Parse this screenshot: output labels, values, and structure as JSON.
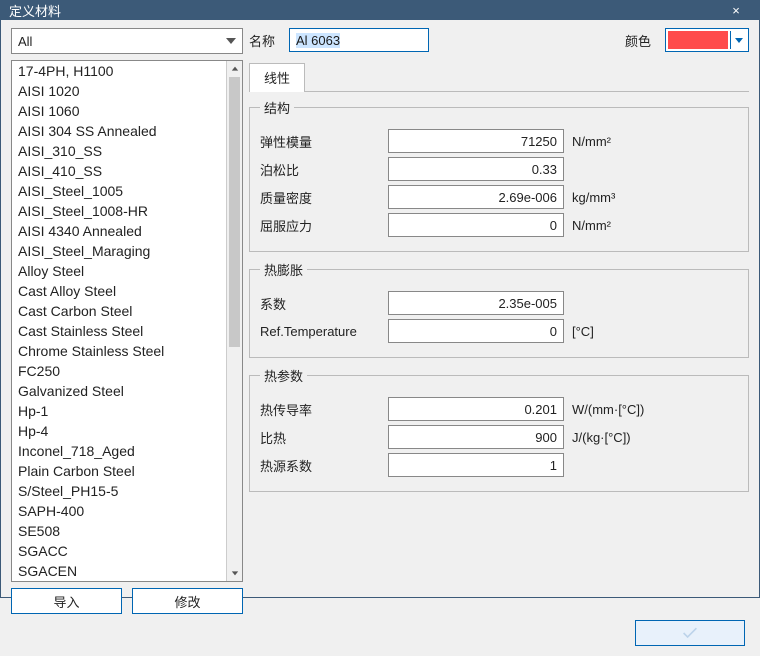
{
  "window": {
    "title": "定义材料"
  },
  "filter": {
    "value": "All"
  },
  "materials": [
    "17-4PH, H1100",
    "AISI 1020",
    "AISI 1060",
    "AISI 304 SS Annealed",
    "AISI_310_SS",
    "AISI_410_SS",
    "AISI_Steel_1005",
    "AISI_Steel_1008-HR",
    "AISI 4340 Annealed",
    "AISI_Steel_Maraging",
    "Alloy Steel",
    "Cast Alloy Steel",
    "Cast Carbon Steel",
    "Cast Stainless Steel",
    "Chrome Stainless Steel",
    "FC250",
    "Galvanized Steel",
    "Hp-1",
    "Hp-4",
    "Inconel_718_Aged",
    "Plain Carbon Steel",
    "S/Steel_PH15-5",
    "SAPH-400",
    "SE508",
    "SGACC",
    "SGACEN"
  ],
  "buttons": {
    "import": "导入",
    "modify": "修改"
  },
  "header": {
    "nameLabel": "名称",
    "nameValue": "Al 6063",
    "colorLabel": "颜色",
    "colorHex": "#ff4b4b"
  },
  "tabs": {
    "linear": "线性"
  },
  "groups": {
    "structure": {
      "legend": "结构",
      "rows": [
        {
          "label": "弹性模量",
          "value": "71250",
          "unit": "N/mm²"
        },
        {
          "label": "泊松比",
          "value": "0.33",
          "unit": ""
        },
        {
          "label": "质量密度",
          "value": "2.69e-006",
          "unit": "kg/mm³"
        },
        {
          "label": "屈服应力",
          "value": "0",
          "unit": "N/mm²"
        }
      ]
    },
    "thermalExp": {
      "legend": "热膨胀",
      "rows": [
        {
          "label": "系数",
          "value": "2.35e-005",
          "unit": ""
        },
        {
          "label": "Ref.Temperature",
          "value": "0",
          "unit": "[°C]"
        }
      ]
    },
    "thermalParam": {
      "legend": "热参数",
      "rows": [
        {
          "label": "热传导率",
          "value": "0.201",
          "unit": "W/(mm·[°C])"
        },
        {
          "label": "比热",
          "value": "900",
          "unit": "J/(kg·[°C])"
        },
        {
          "label": "热源系数",
          "value": "1",
          "unit": ""
        }
      ]
    }
  }
}
